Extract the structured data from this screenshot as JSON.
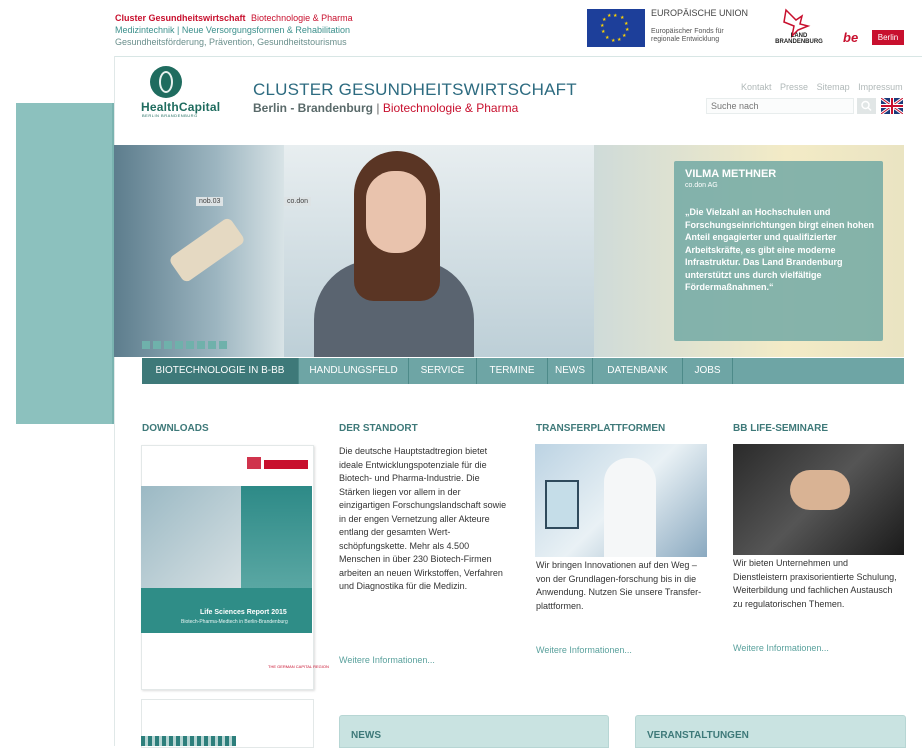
{
  "topbar": {
    "line1_bold": "Cluster Gesundheitswirtschaft",
    "line1_rest": "Biotechnologie & Pharma",
    "line2": "Medizintechnik | Neue Versorgungsformen & Rehabilitation",
    "line3": "Gesundheitsförderung, Prävention, Gesundheitstourismus",
    "eu_title": "EUROPÄISCHE UNION",
    "eu_sub": "Europäischer Fonds für regionale Entwicklung",
    "brandenburg": "LAND BRANDENBURG",
    "berlin_prefix": "be",
    "berlin_box": "Berlin"
  },
  "header": {
    "logo_text": "HealthCapital",
    "logo_sub": "BERLIN BRANDENBURG",
    "title": "CLUSTER GESUNDHEITSWIRTSCHAFT",
    "subtitle_main": "Berlin - Brandenburg",
    "subtitle_pipe": "|",
    "subtitle_red": "Biotechnologie & Pharma",
    "util_links": [
      "Kontakt",
      "Presse",
      "Sitemap",
      "Impressum"
    ],
    "search_placeholder": "Suche nach"
  },
  "hero": {
    "label1": "nob.03",
    "label2": "co.don",
    "quote_name": "VILMA METHNER",
    "quote_company": "co.don AG",
    "quote_text": "„Die Vielzahl an Hochschulen und Forschungseinrichtungen birgt einen hohen Anteil engagierter und qualifizierter Arbeitskräfte, es gibt eine moderne Infrastruktur. Das Land Brandenburg unterstützt uns durch vielfältige Fördermaßnahmen.“",
    "slides_count": 8
  },
  "nav": {
    "items": [
      {
        "label": "BIOTECHNOLOGIE IN B-BB"
      },
      {
        "label": "HANDLUNGSFELD"
      },
      {
        "label": "SERVICE"
      },
      {
        "label": "TERMINE"
      },
      {
        "label": "NEWS"
      },
      {
        "label": "DATENBANK"
      },
      {
        "label": "JOBS"
      }
    ]
  },
  "columns": {
    "downloads": {
      "title": "DOWNLOADS",
      "report_title": "Life Sciences Report 2015",
      "report_sub": "Biotech-Pharma-Medtech in Berlin-Brandenburg",
      "report_tag": "THE GERMAN CAPITAL REGION"
    },
    "standort": {
      "title": "DER STANDORT",
      "text": "Die deutsche Hauptstadtregion bietet ideale Entwicklungspotenziale für die Biotech- und Pharma-Industrie. Die Stärken liegen vor allem in der einzigartigen Forschungslandschaft sowie in der engen Vernetzung aller Akteure entlang der gesamten Wert-schöpfungskette. Mehr als 4.500 Menschen in über 230 Biotech-Firmen arbeiten an neuen Wirkstoffen, Verfahren und Diagnostika für die Medizin.",
      "more": "Weitere Informationen..."
    },
    "transfer": {
      "title": "TRANSFERPLATTFORMEN",
      "text": "Wir bringen Innovationen auf den Weg – von der Grundlagen-forschung bis in die Anwendung. Nutzen Sie unsere Transfer-plattformen.",
      "more": "Weitere Informationen..."
    },
    "seminare": {
      "title": "BB LIFE-SEMINARE",
      "text": "Wir bieten Unternehmen und Dienstleistern praxisorientierte Schulung, Weiterbildung und fachlichen Austausch zu regulatorischen Themen.",
      "more": "Weitere Informationen..."
    }
  },
  "bottom": {
    "news_title": "NEWS",
    "events_title": "VERANSTALTUNGEN"
  }
}
